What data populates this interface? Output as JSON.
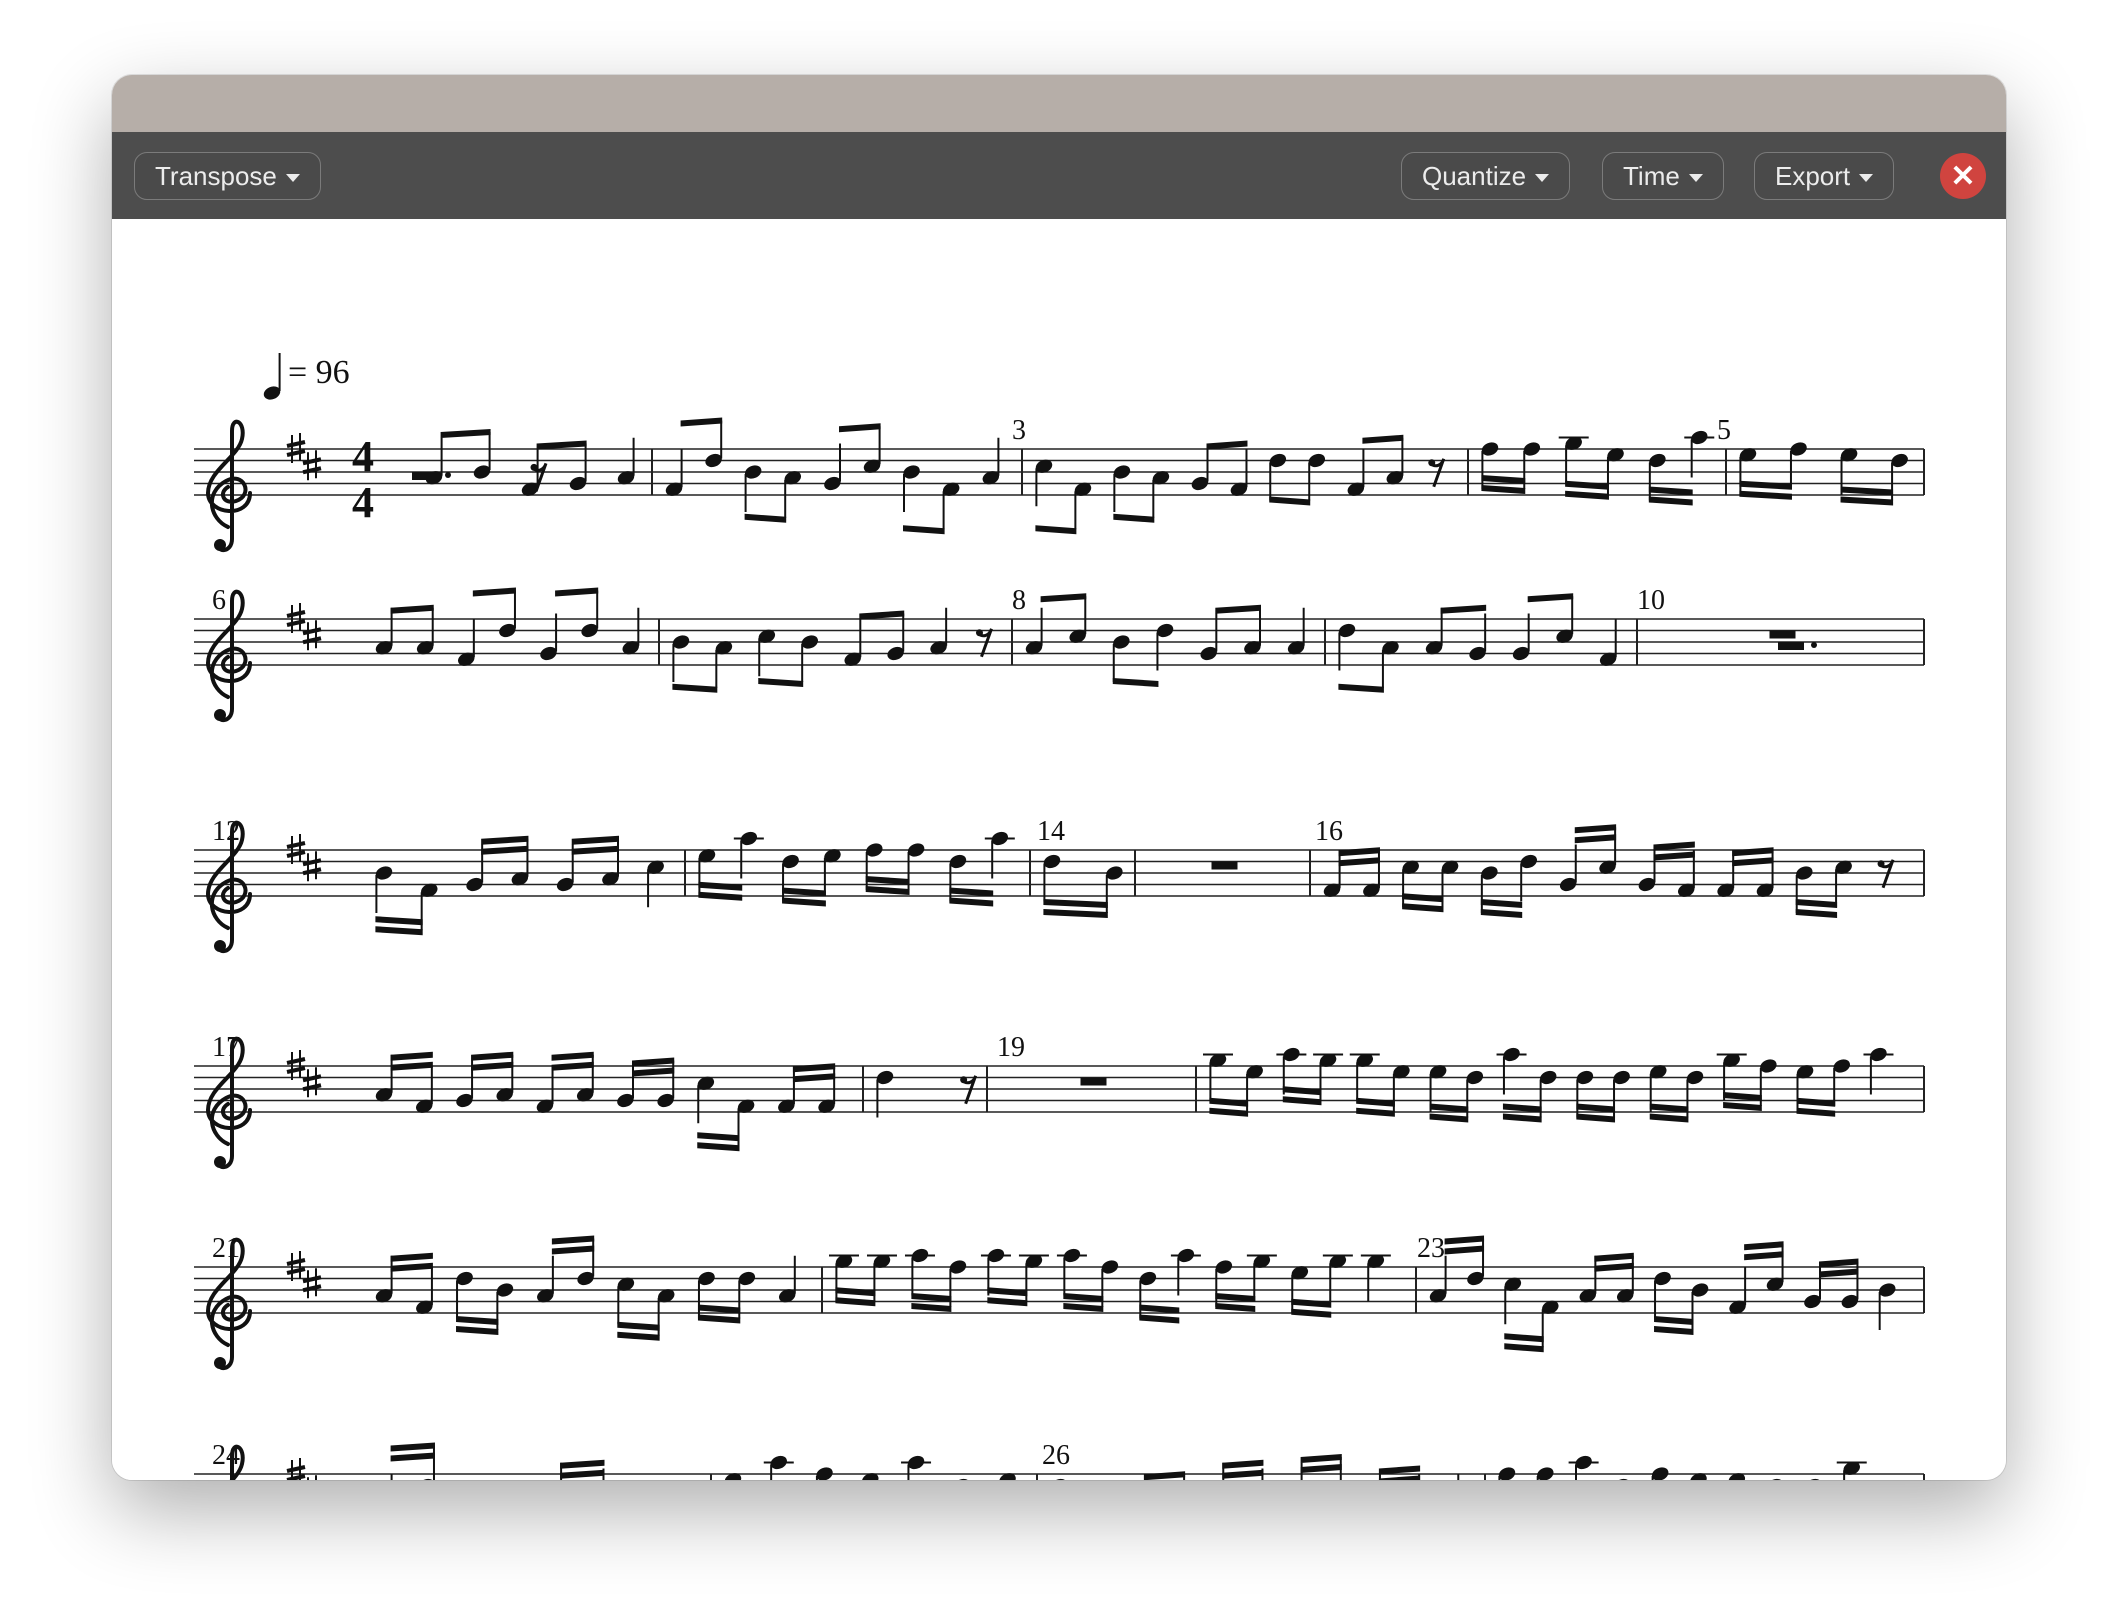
{
  "toolbar": {
    "transpose_label": "Transpose",
    "quantize_label": "Quantize",
    "time_label": "Time",
    "export_label": "Export",
    "close_glyph": "✕"
  },
  "score": {
    "tempo_value": "= 96",
    "time_signature": {
      "top": "4",
      "bottom": "4"
    },
    "key_signature": "D major (F#, C#)",
    "measure_numbers": [
      "3",
      "5",
      "6",
      "8",
      "10",
      "12",
      "14",
      "16",
      "17",
      "19",
      "21",
      "23",
      "24",
      "26"
    ]
  },
  "colors": {
    "titlebar": "#b6aea8",
    "toolbar": "#4d4d4d",
    "close_button": "#d0443f"
  }
}
